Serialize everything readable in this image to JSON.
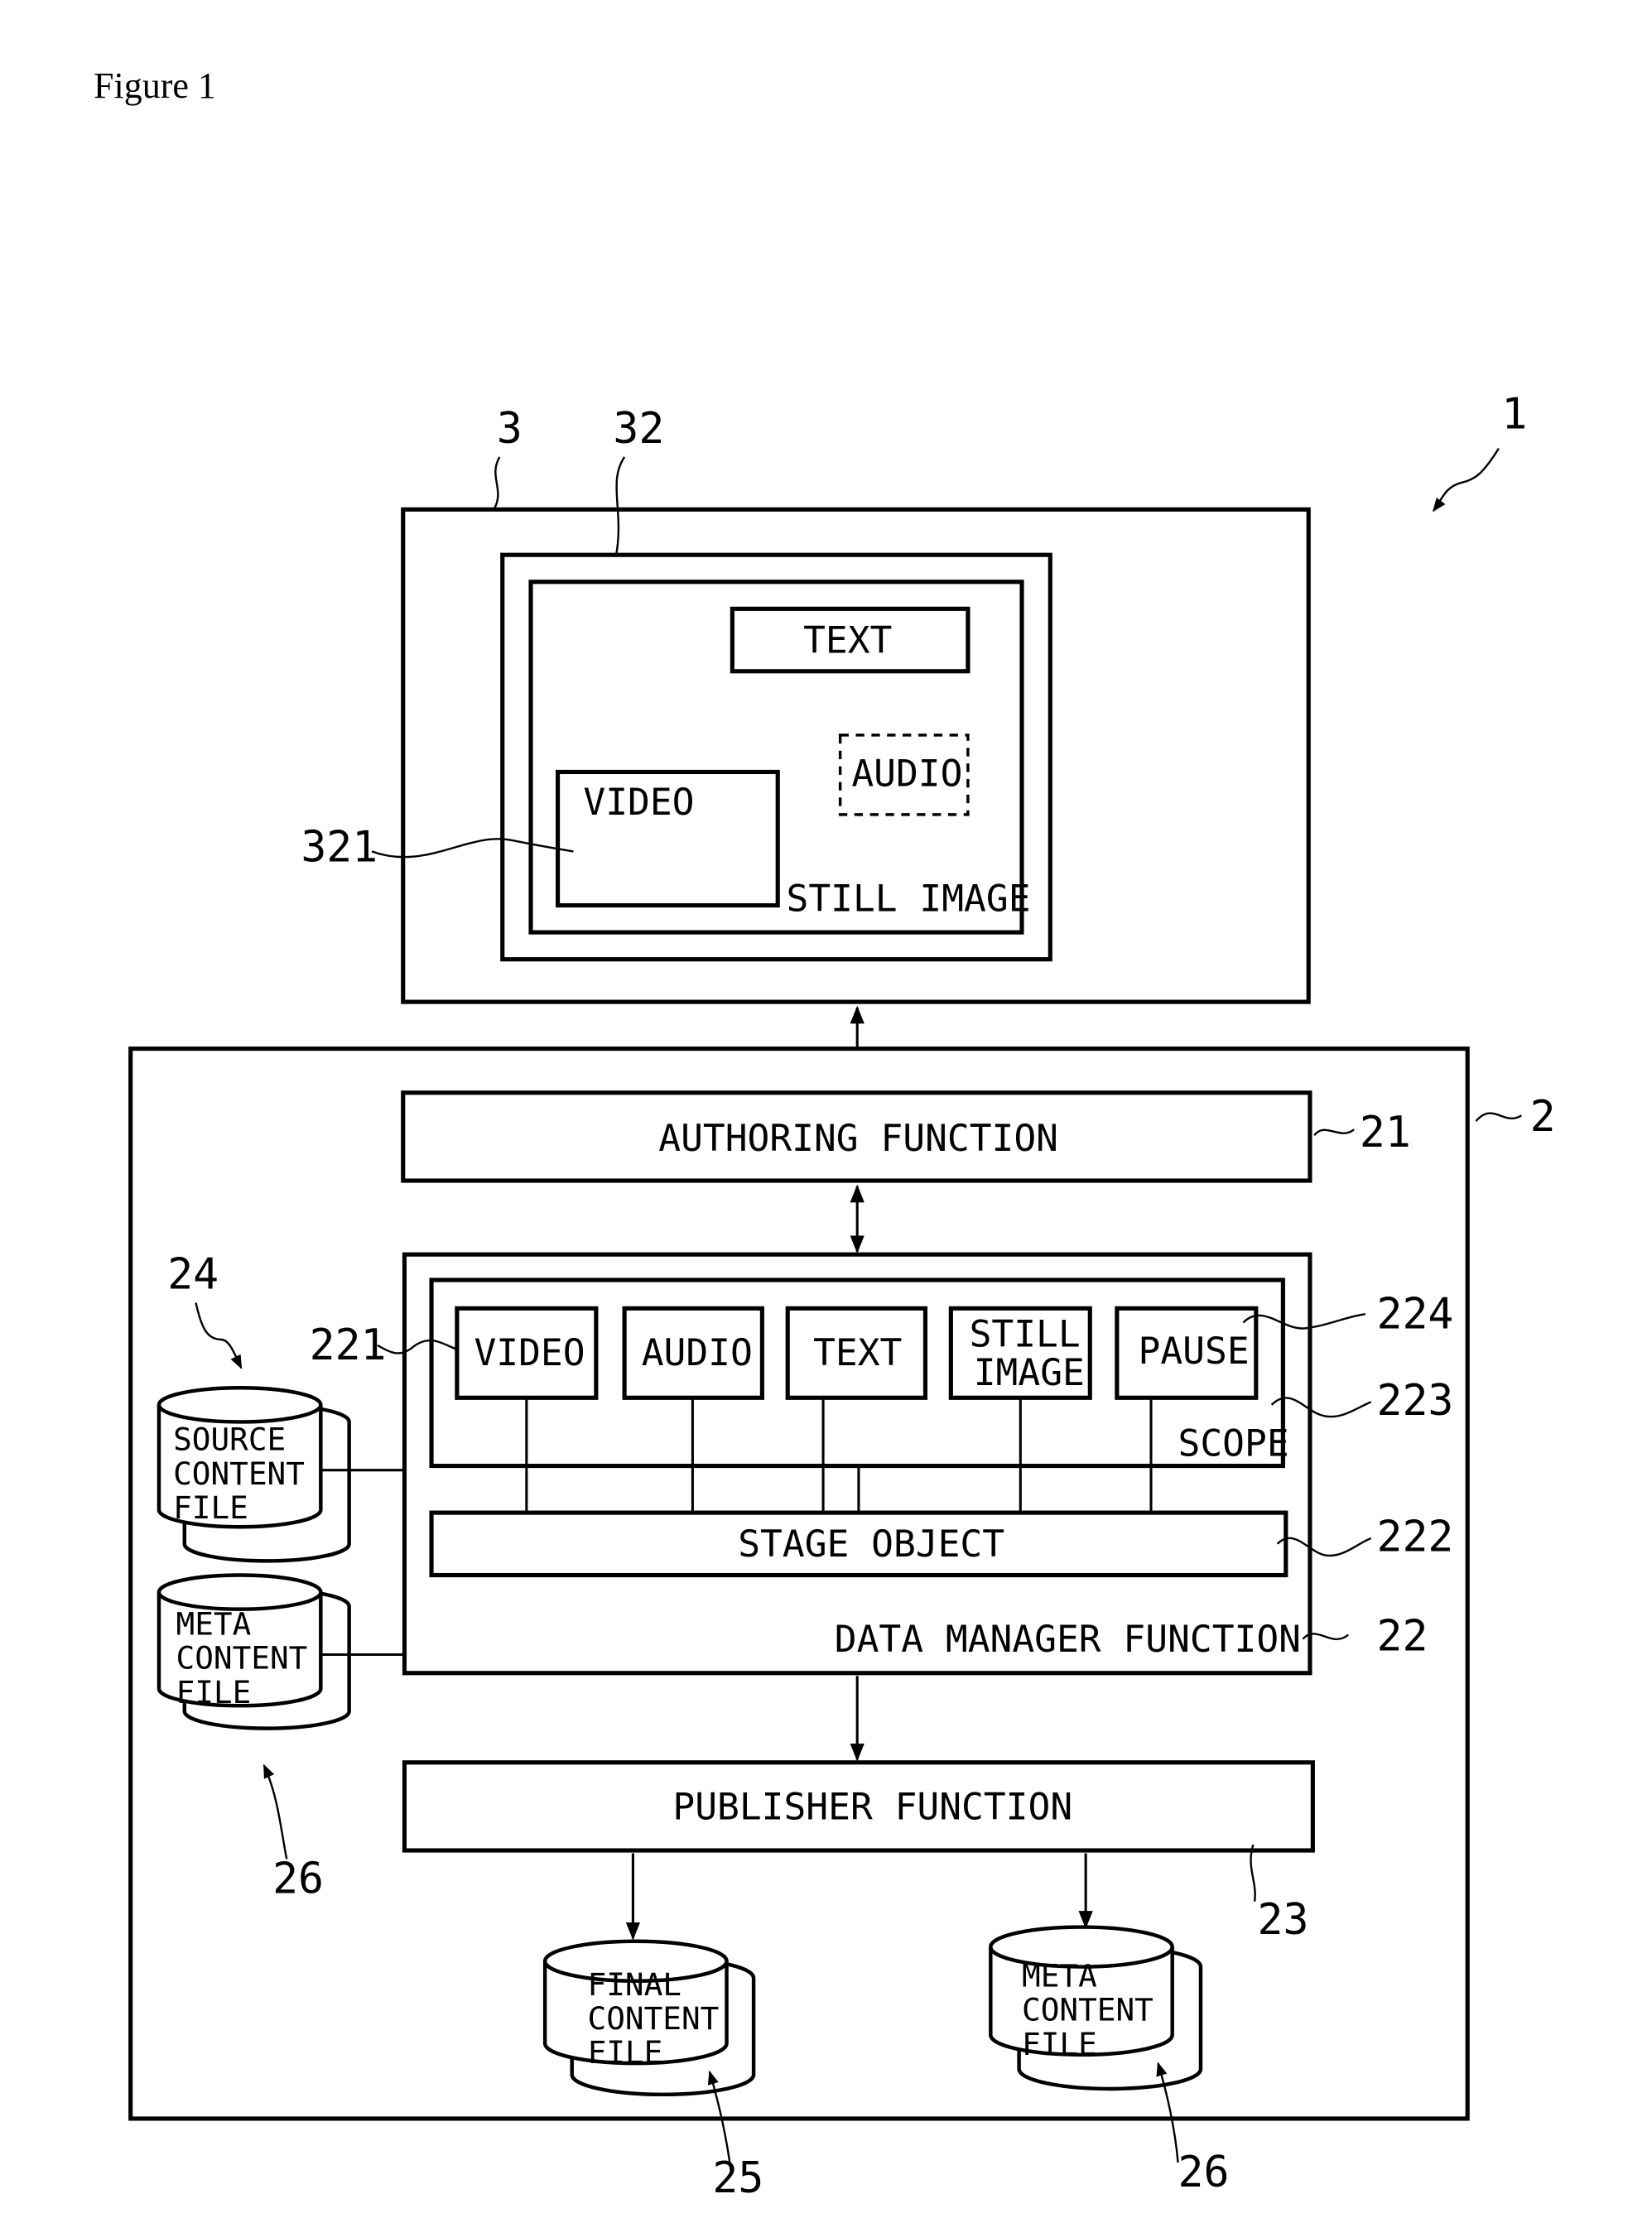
{
  "figure_title": "Figure 1",
  "system": {
    "ref": "1"
  },
  "display": {
    "ref": "3",
    "screen_ref": "32",
    "screen": {
      "background_label": "STILL IMAGE",
      "text_label": "TEXT",
      "audio_label": "AUDIO",
      "video_label": "VIDEO",
      "video_ref": "321"
    }
  },
  "authoring_tool": {
    "ref": "2",
    "authoring": {
      "label": "AUTHORING FUNCTION",
      "ref": "21"
    },
    "data_manager": {
      "label": "DATA MANAGER FUNCTION",
      "ref": "22",
      "stage_object": {
        "label": "STAGE OBJECT",
        "ref": "222"
      },
      "scope": {
        "label": "SCOPE",
        "ref": "223",
        "objects": [
          {
            "label": "VIDEO",
            "ref": "221"
          },
          {
            "label": "AUDIO"
          },
          {
            "label": "TEXT"
          },
          {
            "label_line1": "STILL",
            "label_line2": "IMAGE"
          },
          {
            "label": "PAUSE",
            "ref": "224"
          }
        ]
      }
    },
    "publisher": {
      "label": "PUBLISHER FUNCTION",
      "ref": "23"
    },
    "files": {
      "source": {
        "lines": [
          "SOURCE",
          "CONTENT",
          "FILE"
        ],
        "ref": "24"
      },
      "meta_input": {
        "lines": [
          "META",
          "CONTENT",
          "FILE"
        ],
        "ref": "26"
      },
      "final": {
        "lines": [
          "FINAL",
          "CONTENT",
          "FILE"
        ],
        "ref": "25"
      },
      "meta_output": {
        "lines": [
          "META",
          "CONTENT",
          "FILE"
        ],
        "ref": "26"
      }
    }
  }
}
